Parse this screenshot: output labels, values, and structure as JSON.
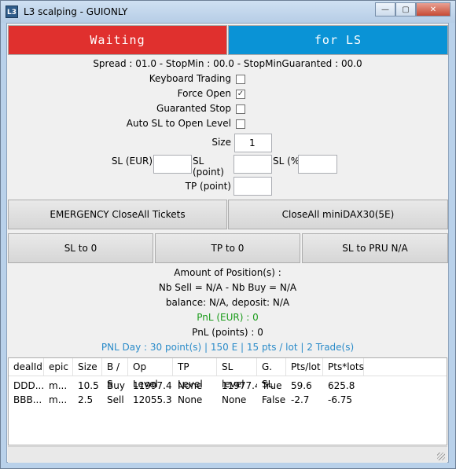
{
  "window": {
    "title": "L3 scalping - GUIONLY",
    "icon": "L3",
    "min": "—",
    "max": "▢",
    "close": "✕"
  },
  "status": {
    "waiting": "Waiting",
    "for_ls": "for LS"
  },
  "spread_line": "Spread : 01.0 - StopMin : 00.0 - StopMinGuaranted : 00.0",
  "options": {
    "keyboard_trading": {
      "label": "Keyboard Trading",
      "checked": false
    },
    "force_open": {
      "label": "Force Open",
      "checked": true
    },
    "guaranted_stop": {
      "label": "Guaranted Stop",
      "checked": false
    },
    "auto_sl": {
      "label": "Auto SL to Open Level",
      "checked": false
    }
  },
  "size": {
    "label": "Size",
    "value": "1"
  },
  "sl": {
    "eur_label": "SL (EUR)",
    "point_label": "SL (point)",
    "pct_label": "SL (%)",
    "eur_value": "",
    "point_value": "",
    "pct_value": ""
  },
  "tp": {
    "label": "TP (point)",
    "value": ""
  },
  "buttons": {
    "emergency": "EMERGENCY CloseAll Tickets",
    "closeall_mini": "CloseAll miniDAX30(5E)",
    "sl_to_0": "SL to 0",
    "tp_to_0": "TP to 0",
    "sl_to_pru": "SL to PRU   N/A"
  },
  "summary": {
    "amount": "Amount of Position(s) :",
    "nb": "Nb Sell = N/A - Nb Buy = N/A",
    "balance": "balance: N/A, deposit: N/A",
    "pnl_eur": "PnL (EUR) : 0",
    "pnl_points": "PnL (points) : 0",
    "pnl_day": "PNL Day : 30 point(s) | 150 E | 15 pts / lot  | 2 Trade(s)"
  },
  "colors": {
    "waiting_bg": "#e0302e",
    "for_ls_bg": "#0a93d6",
    "pnl_green": "#1a9b1a",
    "pnl_day_blue": "#2a8bc9"
  },
  "table": {
    "headers": [
      "dealId",
      "epic",
      "Size",
      "B / S",
      "Op Level",
      "TP Level",
      "SL level",
      "G. SL",
      "Pts/lot",
      "Pts*lots"
    ],
    "rows": [
      [
        "DDD...",
        "m...",
        "10.5",
        "Buy",
        "11997.4",
        "None",
        "11977.4",
        "True",
        "59.6",
        "625.8"
      ],
      [
        "BBB...",
        "m...",
        "2.5",
        "Sell",
        "12055.3",
        "None",
        "None",
        "False",
        "-2.7",
        "-6.75"
      ]
    ]
  }
}
